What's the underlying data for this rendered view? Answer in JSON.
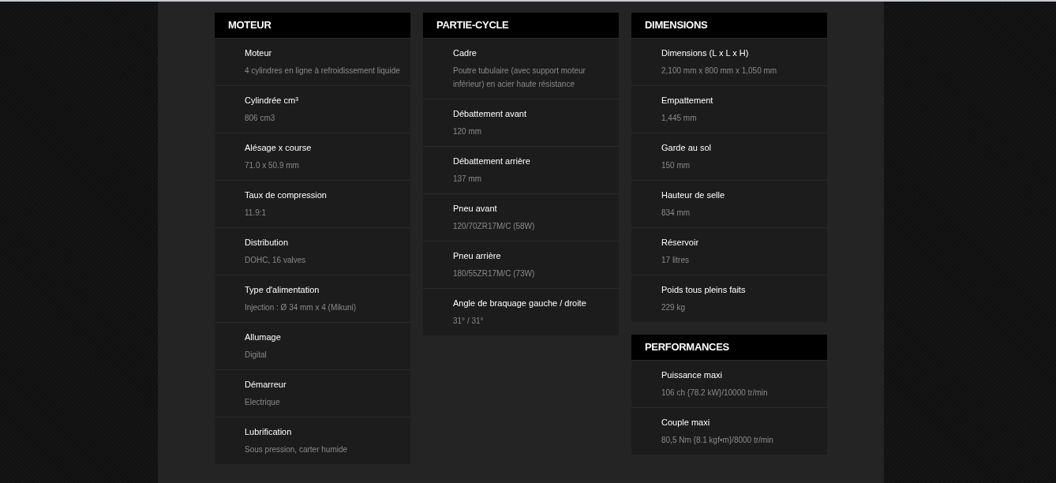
{
  "columns": [
    {
      "sections": [
        {
          "title": "MOTEUR",
          "specs": [
            {
              "label": "Moteur",
              "value": "4 cylindres en ligne à refroidissement liquide"
            },
            {
              "label": "Cylindrée cm³",
              "value": "806 cm3"
            },
            {
              "label": "Alésage x course",
              "value": "71.0 x 50.9 mm"
            },
            {
              "label": "Taux de compression",
              "value": "11.9:1"
            },
            {
              "label": "Distribution",
              "value": "DOHC, 16 valves"
            },
            {
              "label": "Type d'alimentation",
              "value": "Injection : Ø 34 mm x 4 (Mikuni)"
            },
            {
              "label": "Allumage",
              "value": "Digital"
            },
            {
              "label": "Démarreur",
              "value": "Electrique"
            },
            {
              "label": "Lubrification",
              "value": "Sous pression, carter humide"
            }
          ]
        }
      ]
    },
    {
      "sections": [
        {
          "title": "PARTIE-CYCLE",
          "specs": [
            {
              "label": "Cadre",
              "value": "Poutre tubulaire (avec support moteur inférieur) en acier haute résistance"
            },
            {
              "label": "Débattement avant",
              "value": "120 mm"
            },
            {
              "label": "Débattement arrière",
              "value": "137 mm"
            },
            {
              "label": "Pneu avant",
              "value": "120/70ZR17M/C (58W)"
            },
            {
              "label": "Pneu arrière",
              "value": "180/55ZR17M/C (73W)"
            },
            {
              "label": "Angle de braquage gauche / droite",
              "value": "31° / 31°"
            }
          ]
        }
      ]
    },
    {
      "sections": [
        {
          "title": "DIMENSIONS",
          "specs": [
            {
              "label": "Dimensions (L x L x H)",
              "value": "2,100 mm x 800 mm x 1,050 mm"
            },
            {
              "label": "Empattement",
              "value": "1,445 mm"
            },
            {
              "label": "Garde au sol",
              "value": "150 mm"
            },
            {
              "label": "Hauteur de selle",
              "value": "834 mm"
            },
            {
              "label": "Réservoir",
              "value": "17 litres"
            },
            {
              "label": "Poids tous pleins faits",
              "value": "229 kg"
            }
          ]
        },
        {
          "title": "PERFORMANCES",
          "specs": [
            {
              "label": "Puissance maxi",
              "value": "106 ch {78.2 kW}/10000 tr/min"
            },
            {
              "label": "Couple maxi",
              "value": "80,5 Nm {8.1 kgf•m}/8000 tr/min"
            }
          ]
        }
      ]
    }
  ]
}
